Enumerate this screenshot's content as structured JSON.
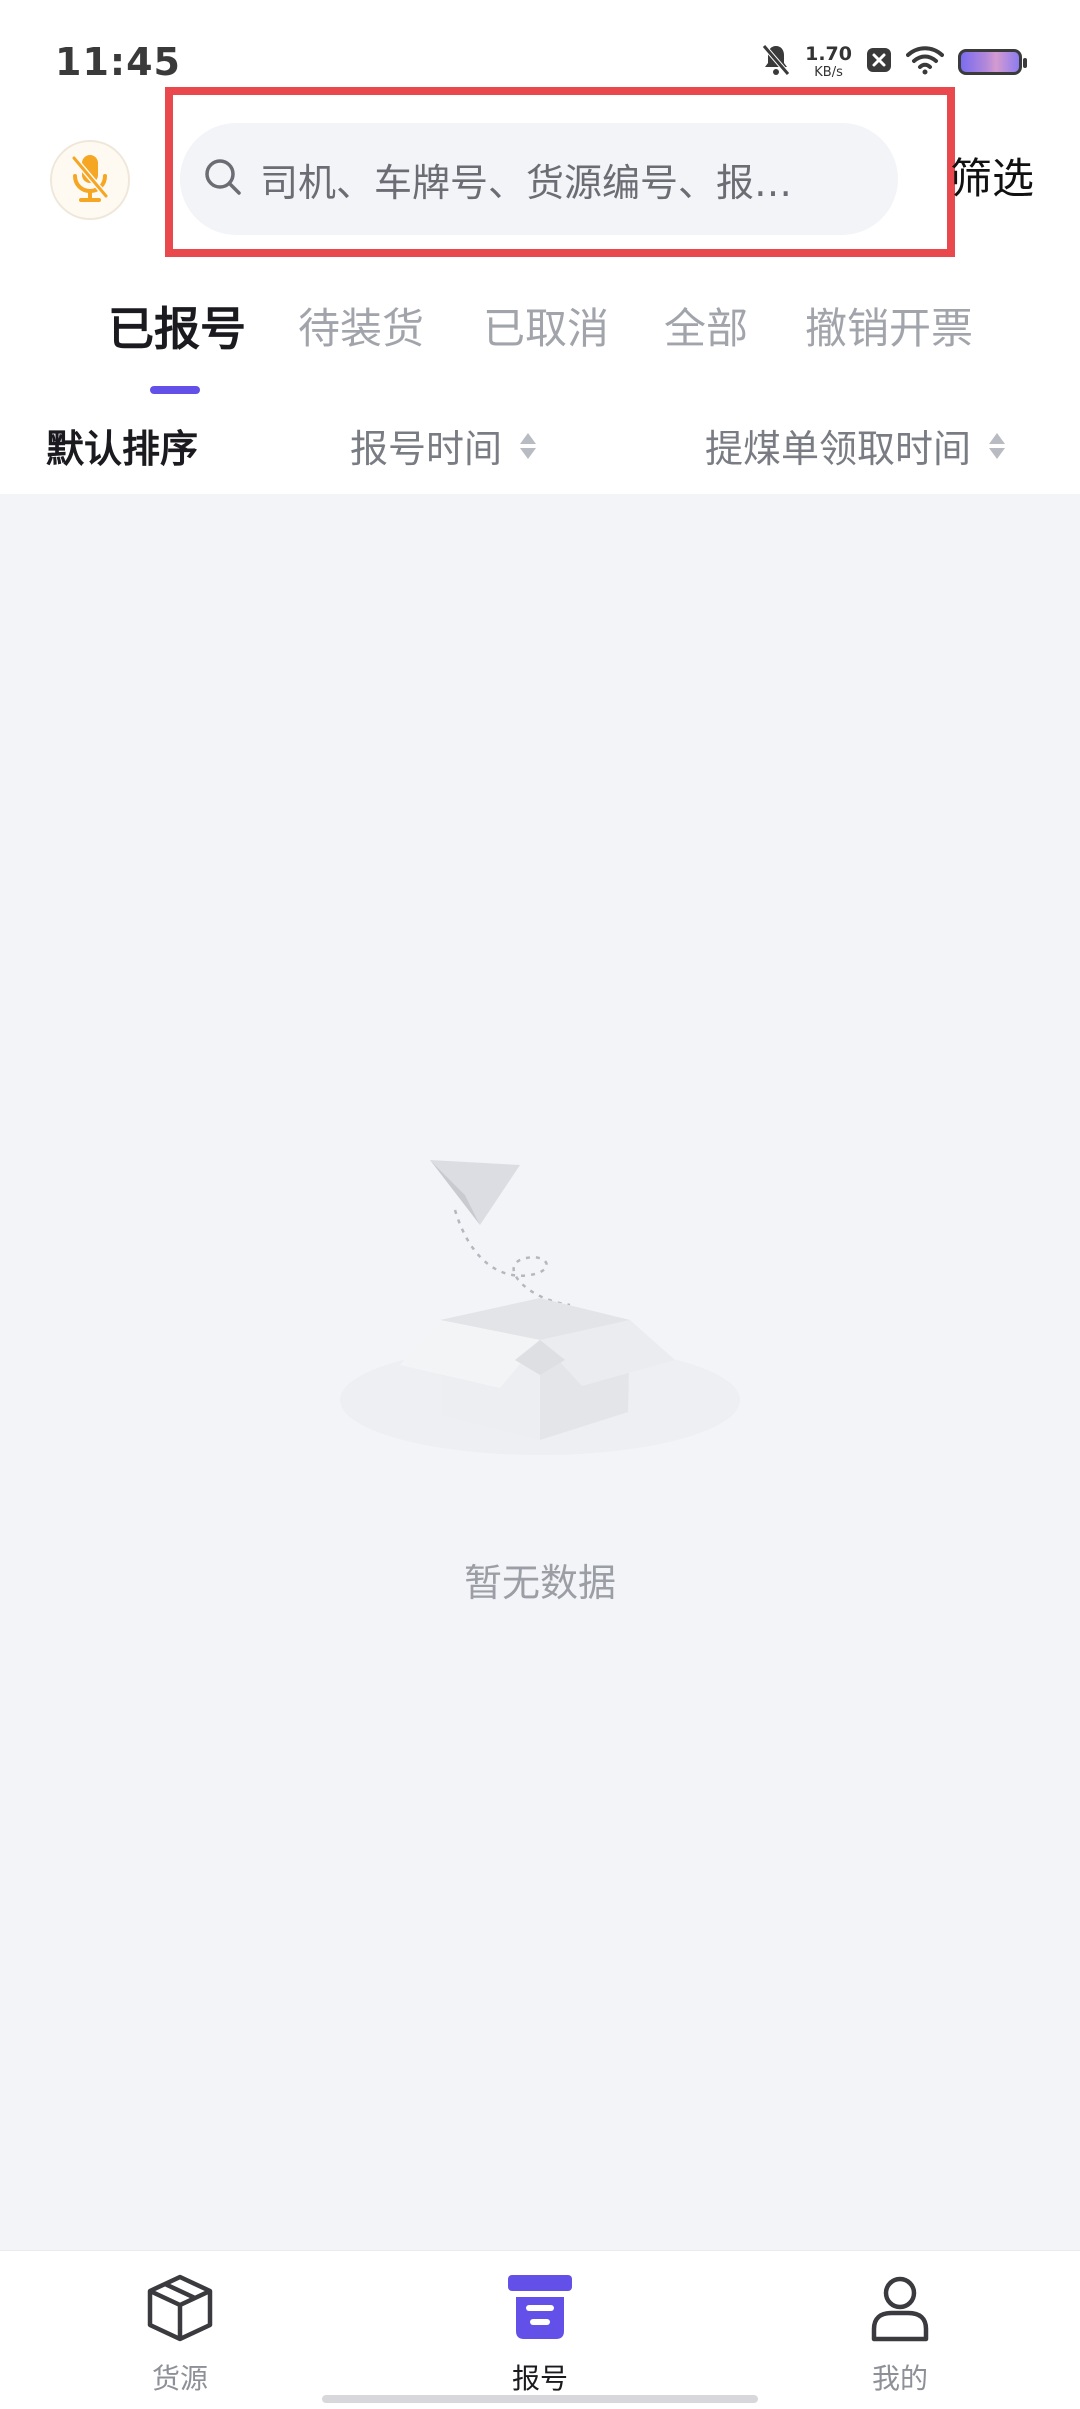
{
  "status_bar": {
    "time": "11:45",
    "speed_value": "1.70",
    "speed_unit": "KB/s",
    "icons": [
      "bell-muted-icon",
      "close-box-icon",
      "wifi-icon",
      "battery-icon"
    ]
  },
  "header": {
    "mic_icon": "mic-muted-icon",
    "search_placeholder": "司机、车牌号、货源编号、报…",
    "filter_label": "筛选"
  },
  "tabs": [
    {
      "label": "已报号",
      "active": true
    },
    {
      "label": "待装货",
      "active": false
    },
    {
      "label": "已取消",
      "active": false
    },
    {
      "label": "全部",
      "active": false
    },
    {
      "label": "撤销开票",
      "active": false
    }
  ],
  "sort": {
    "default_label": "默认排序",
    "report_time_label": "报号时间",
    "pickup_time_label": "提煤单领取时间"
  },
  "empty": {
    "text": "暂无数据",
    "icon": "empty-box-paper-plane-icon"
  },
  "bottom_nav": [
    {
      "label": "货源",
      "icon": "box-icon",
      "active": false
    },
    {
      "label": "报号",
      "icon": "report-icon",
      "active": true
    },
    {
      "label": "我的",
      "icon": "user-icon",
      "active": false
    }
  ],
  "colors": {
    "accent": "#6250e8",
    "highlight_border": "#e9484d",
    "mic_orange": "#f5a623",
    "background": "#f3f4f8"
  }
}
